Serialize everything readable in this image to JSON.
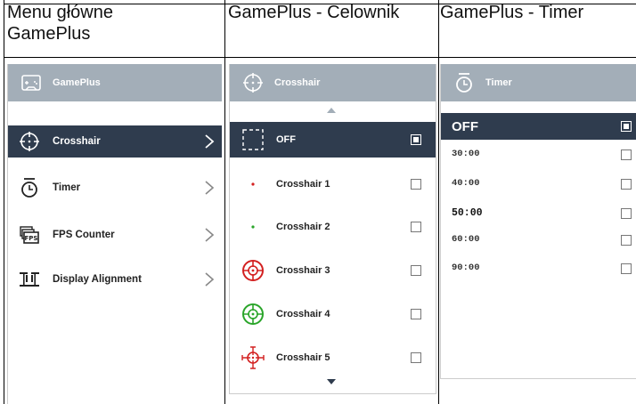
{
  "columns": [
    {
      "title_line1": "Menu główne",
      "title_line2": "GamePlus"
    },
    {
      "title": "GamePlus - Celownik"
    },
    {
      "title": "GamePlus - Timer"
    }
  ],
  "main_menu": {
    "header": {
      "icon": "gamepad-icon",
      "label": "GamePlus"
    },
    "items": [
      {
        "label": "Crosshair",
        "icon": "crosshair-icon",
        "selected": true
      },
      {
        "label": "Timer",
        "icon": "timer-icon",
        "selected": false
      },
      {
        "label": "FPS Counter",
        "icon": "fps-counter-icon",
        "selected": false
      },
      {
        "label": "Display Alignment",
        "icon": "display-alignment-icon",
        "selected": false
      }
    ]
  },
  "crosshair_menu": {
    "header": {
      "icon": "crosshair-icon",
      "label": "Crosshair"
    },
    "items": [
      {
        "label": "OFF",
        "selected": true
      },
      {
        "label": "Crosshair 1",
        "selected": false,
        "color": "#d32020"
      },
      {
        "label": "Crosshair 2",
        "selected": false,
        "color": "#2aa52a"
      },
      {
        "label": "Crosshair 3",
        "selected": false,
        "color": "#d32020"
      },
      {
        "label": "Crosshair 4",
        "selected": false,
        "color": "#2aa52a"
      },
      {
        "label": "Crosshair 5",
        "selected": false,
        "color": "#d32020"
      }
    ]
  },
  "timer_menu": {
    "header": {
      "icon": "timer-icon",
      "label": "Timer"
    },
    "items": [
      {
        "label": "OFF",
        "selected": true
      },
      {
        "label": "30:00",
        "selected": false
      },
      {
        "label": "40:00",
        "selected": false
      },
      {
        "label": "50:00",
        "selected": false
      },
      {
        "label": "60:00",
        "selected": false
      },
      {
        "label": "90:00",
        "selected": false
      }
    ]
  },
  "colors": {
    "header_bg": "#a3aeb8",
    "selected_bg": "#2f3c4e",
    "red": "#d32020",
    "green": "#2aa52a"
  }
}
